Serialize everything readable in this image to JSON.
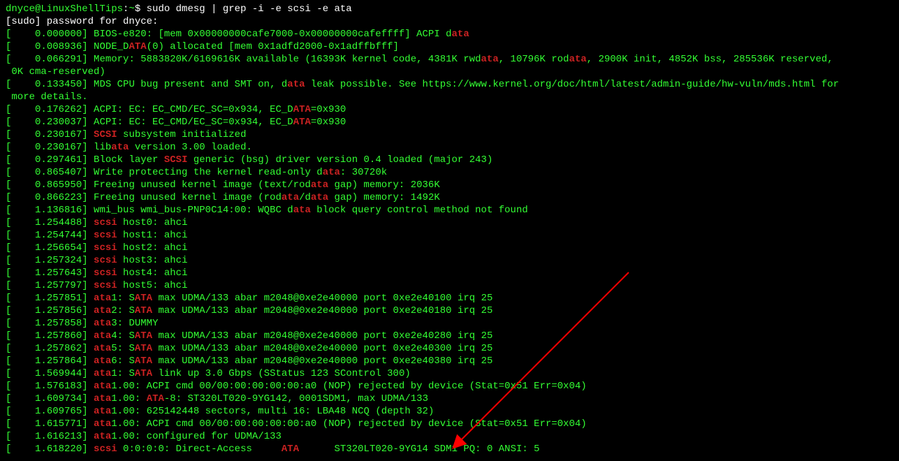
{
  "prompt": {
    "user": "dnyce@LinuxShellTips",
    "sep": ":",
    "path": "~",
    "dollar": "$",
    "command": " sudo dmesg | grep -i -e scsi -e ata"
  },
  "sudoLine": "[sudo] password for dnyce:",
  "lines": [
    {
      "ts": "    0.000000",
      "pre": "] BIOS-e820: [mem 0x00000000cafe7000-0x00000000cafeffff] ACPI d",
      "m1": "ata",
      "post": ""
    },
    {
      "ts": "    0.008936",
      "pre": "] NODE_D",
      "m1": "ATA",
      "post": "(0) allocated [mem 0x1adfd2000-0x1adffbfff]"
    },
    {
      "ts": "    0.066291",
      "pre": "] Memory: 5883820K/6169616K available (16393K kernel code, 4381K rwd",
      "m1": "ata",
      "mid1": ", 10796K rod",
      "m2": "ata",
      "post": ", 2900K init, 4852K bss, 285536K reserved,"
    },
    {
      "raw": " 0K cma-reserved)"
    },
    {
      "ts": "    0.133450",
      "pre": "] MDS CPU bug present and SMT on, d",
      "m1": "ata",
      "post": " leak possible. See https://www.kernel.org/doc/html/latest/admin-guide/hw-vuln/mds.html for"
    },
    {
      "raw": " more details."
    },
    {
      "ts": "    0.176262",
      "pre": "] ACPI: EC: EC_CMD/EC_SC=0x934, EC_D",
      "m1": "ATA",
      "post": "=0x930"
    },
    {
      "ts": "    0.230037",
      "pre": "] ACPI: EC: EC_CMD/EC_SC=0x934, EC_D",
      "m1": "ATA",
      "post": "=0x930"
    },
    {
      "ts": "    0.230167",
      "pre": "] ",
      "m1": "SCSI",
      "post": " subsystem initialized"
    },
    {
      "ts": "    0.230167",
      "pre": "] lib",
      "m1": "ata",
      "post": " version 3.00 loaded."
    },
    {
      "ts": "    0.297461",
      "pre": "] Block layer ",
      "m1": "SCSI",
      "post": " generic (bsg) driver version 0.4 loaded (major 243)"
    },
    {
      "ts": "    0.865407",
      "pre": "] Write protecting the kernel read-only d",
      "m1": "ata",
      "post": ": 30720k"
    },
    {
      "ts": "    0.865950",
      "pre": "] Freeing unused kernel image (text/rod",
      "m1": "ata",
      "post": " gap) memory: 2036K"
    },
    {
      "ts": "    0.866223",
      "pre": "] Freeing unused kernel image (rod",
      "m1": "ata",
      "mid1": "/d",
      "m2": "ata",
      "post": " gap) memory: 1492K"
    },
    {
      "ts": "    1.136816",
      "pre": "] wmi_bus wmi_bus-PNP0C14:00: WQBC d",
      "m1": "ata",
      "post": " block query control method not found"
    },
    {
      "ts": "    1.254488",
      "pre": "] ",
      "m1": "scsi",
      "post": " host0: ahci"
    },
    {
      "ts": "    1.254744",
      "pre": "] ",
      "m1": "scsi",
      "post": " host1: ahci"
    },
    {
      "ts": "    1.256654",
      "pre": "] ",
      "m1": "scsi",
      "post": " host2: ahci"
    },
    {
      "ts": "    1.257324",
      "pre": "] ",
      "m1": "scsi",
      "post": " host3: ahci"
    },
    {
      "ts": "    1.257643",
      "pre": "] ",
      "m1": "scsi",
      "post": " host4: ahci"
    },
    {
      "ts": "    1.257797",
      "pre": "] ",
      "m1": "scsi",
      "post": " host5: ahci"
    },
    {
      "ts": "    1.257851",
      "pre": "] ",
      "m1": "ata",
      "mid1": "1: S",
      "m2": "ATA",
      "post": " max UDMA/133 abar m2048@0xe2e40000 port 0xe2e40100 irq 25"
    },
    {
      "ts": "    1.257856",
      "pre": "] ",
      "m1": "ata",
      "mid1": "2: S",
      "m2": "ATA",
      "post": " max UDMA/133 abar m2048@0xe2e40000 port 0xe2e40180 irq 25"
    },
    {
      "ts": "    1.257858",
      "pre": "] ",
      "m1": "ata",
      "post": "3: DUMMY"
    },
    {
      "ts": "    1.257860",
      "pre": "] ",
      "m1": "ata",
      "mid1": "4: S",
      "m2": "ATA",
      "post": " max UDMA/133 abar m2048@0xe2e40000 port 0xe2e40280 irq 25"
    },
    {
      "ts": "    1.257862",
      "pre": "] ",
      "m1": "ata",
      "mid1": "5: S",
      "m2": "ATA",
      "post": " max UDMA/133 abar m2048@0xe2e40000 port 0xe2e40300 irq 25"
    },
    {
      "ts": "    1.257864",
      "pre": "] ",
      "m1": "ata",
      "mid1": "6: S",
      "m2": "ATA",
      "post": " max UDMA/133 abar m2048@0xe2e40000 port 0xe2e40380 irq 25"
    },
    {
      "ts": "    1.569944",
      "pre": "] ",
      "m1": "ata",
      "mid1": "1: S",
      "m2": "ATA",
      "post": " link up 3.0 Gbps (SStatus 123 SControl 300)"
    },
    {
      "ts": "    1.576183",
      "pre": "] ",
      "m1": "ata",
      "post": "1.00: ACPI cmd 00/00:00:00:00:00:a0 (NOP) rejected by device (Stat=0x51 Err=0x04)"
    },
    {
      "ts": "    1.609734",
      "pre": "] ",
      "m1": "ata",
      "mid1": "1.00: ",
      "m2": "ATA",
      "post": "-8: ST320LT020-9YG142, 0001SDM1, max UDMA/133"
    },
    {
      "ts": "    1.609765",
      "pre": "] ",
      "m1": "ata",
      "post": "1.00: 625142448 sectors, multi 16: LBA48 NCQ (depth 32)"
    },
    {
      "ts": "    1.615771",
      "pre": "] ",
      "m1": "ata",
      "post": "1.00: ACPI cmd 00/00:00:00:00:00:a0 (NOP) rejected by device (Stat=0x51 Err=0x04)"
    },
    {
      "ts": "    1.616213",
      "pre": "] ",
      "m1": "ata",
      "post": "1.00: configured for UDMA/133"
    },
    {
      "ts": "    1.618220",
      "pre": "] ",
      "m1": "scsi",
      "mid1": " 0:0:0:0: Direct-Access     ",
      "m2": "ATA",
      "post": "      ST320LT020-9YG14 SDM1 PQ: 0 ANSI: 5"
    }
  ]
}
